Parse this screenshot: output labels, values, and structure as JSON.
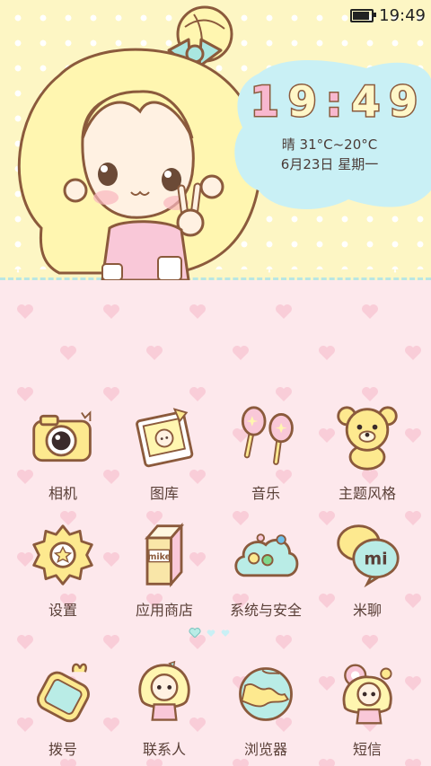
{
  "status_bar": {
    "time": "19:49",
    "battery_icon": "battery-icon"
  },
  "clock_widget": {
    "time_hours": "19",
    "time_minutes": "49",
    "weather": "晴 31°C~20°C",
    "date": "6月23日 星期一"
  },
  "apps_row1": [
    {
      "label": "相机",
      "icon": "camera-icon"
    },
    {
      "label": "图库",
      "icon": "gallery-icon"
    },
    {
      "label": "音乐",
      "icon": "music-icon"
    },
    {
      "label": "主题风格",
      "icon": "theme-bear-icon"
    }
  ],
  "apps_row2": [
    {
      "label": "设置",
      "icon": "settings-gear-icon"
    },
    {
      "label": "应用商店",
      "icon": "app-store-icon",
      "badge": "mike"
    },
    {
      "label": "系统与安全",
      "icon": "security-cloud-icon"
    },
    {
      "label": "米聊",
      "icon": "miliao-chat-icon",
      "badge": "mi"
    }
  ],
  "dock": [
    {
      "label": "拨号",
      "icon": "phone-icon"
    },
    {
      "label": "联系人",
      "icon": "contacts-girl-icon"
    },
    {
      "label": "浏览器",
      "icon": "browser-globe-icon"
    },
    {
      "label": "短信",
      "icon": "sms-icon"
    }
  ],
  "page_indicator": {
    "pages": 3,
    "current": 1
  },
  "colors": {
    "top_bg": "#fdf6c4",
    "bottom_bg": "#fde8ec",
    "heart": "#f9cdd8",
    "outline": "#8b5a3c",
    "cloud": "#c9f0f5",
    "label_text": "#5a4038"
  }
}
